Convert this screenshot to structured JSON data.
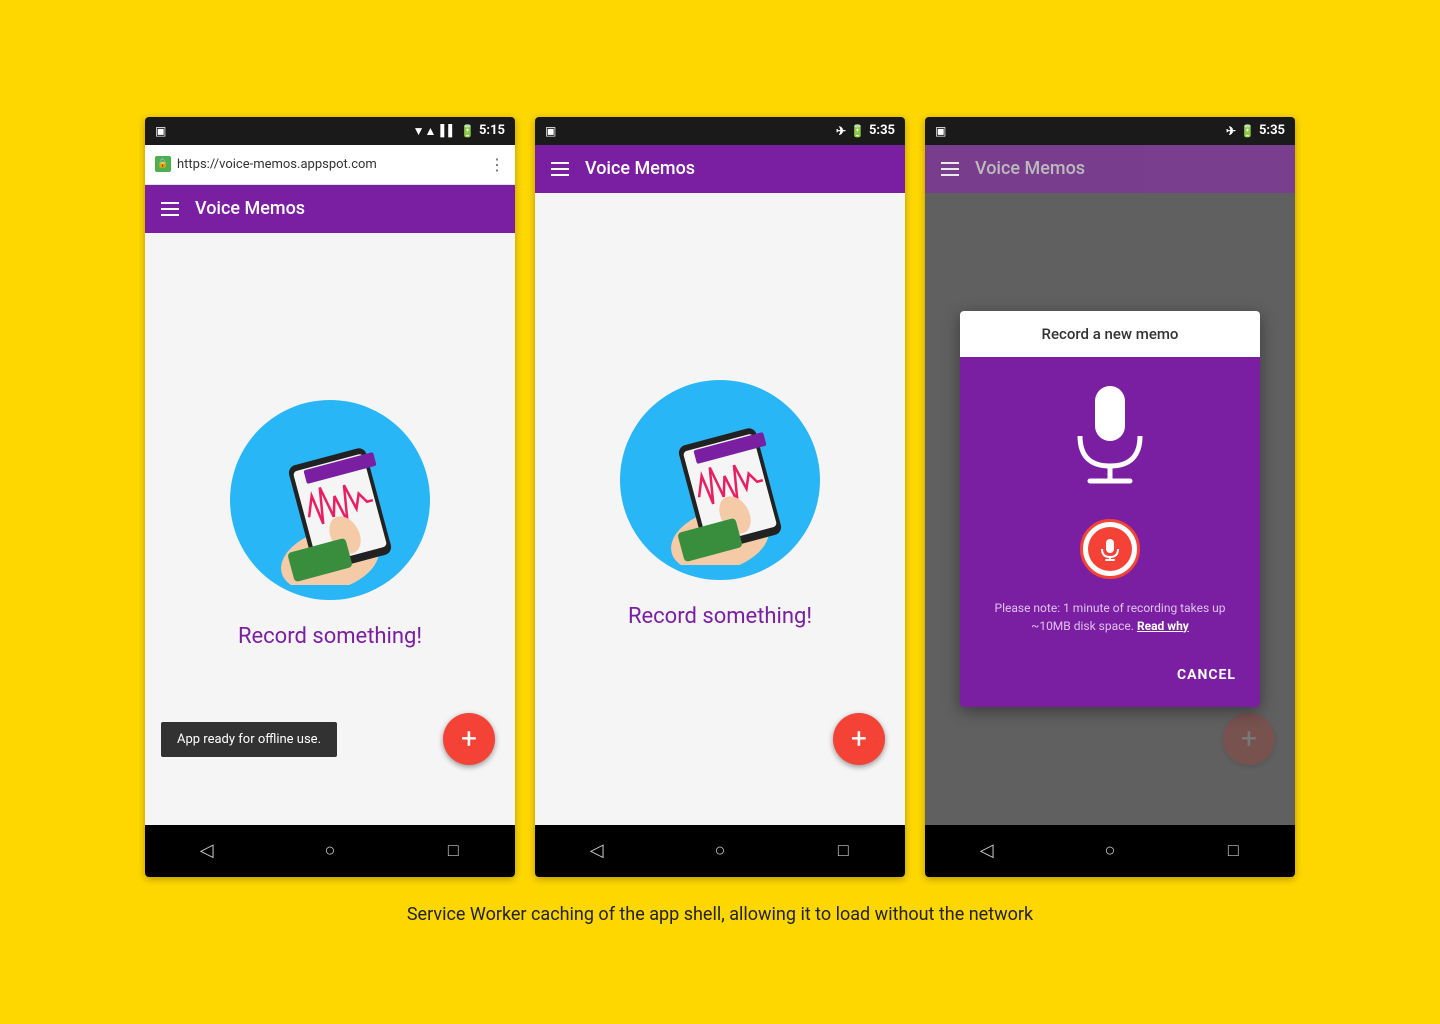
{
  "page": {
    "background_color": "#FFD700",
    "caption": "Service Worker caching of the app shell, allowing it to load without the network"
  },
  "phone1": {
    "status_bar": {
      "left_icon": "📱",
      "time": "5:15",
      "icons": "▼▲"
    },
    "url_bar": {
      "url": "https://voice-memos.appspot.com",
      "lock": "🔒",
      "more": "⋮"
    },
    "toolbar": {
      "title": "Voice Memos",
      "menu_icon": "hamburger"
    },
    "content": {
      "record_text": "Record something!",
      "fab_icon": "+"
    },
    "snackbar": {
      "text": "App ready for offline use."
    },
    "bottom_nav": {
      "back": "◁",
      "home": "○",
      "recent": "□"
    }
  },
  "phone2": {
    "status_bar": {
      "time": "5:35",
      "airplane": "✈"
    },
    "toolbar": {
      "title": "Voice Memos",
      "menu_icon": "hamburger"
    },
    "content": {
      "record_text": "Record something!",
      "fab_icon": "+"
    },
    "bottom_nav": {
      "back": "◁",
      "home": "○",
      "recent": "□"
    }
  },
  "phone3": {
    "status_bar": {
      "time": "5:35",
      "airplane": "✈"
    },
    "toolbar": {
      "title": "Voice Memos",
      "menu_icon": "hamburger"
    },
    "dialog": {
      "title": "Record a new memo",
      "note": "Please note: 1 minute of recording takes up ~10MB disk space.",
      "read_why": "Read why",
      "cancel": "CANCEL"
    },
    "fab_icon": "+",
    "bottom_nav": {
      "back": "◁",
      "home": "○",
      "recent": "□"
    }
  }
}
